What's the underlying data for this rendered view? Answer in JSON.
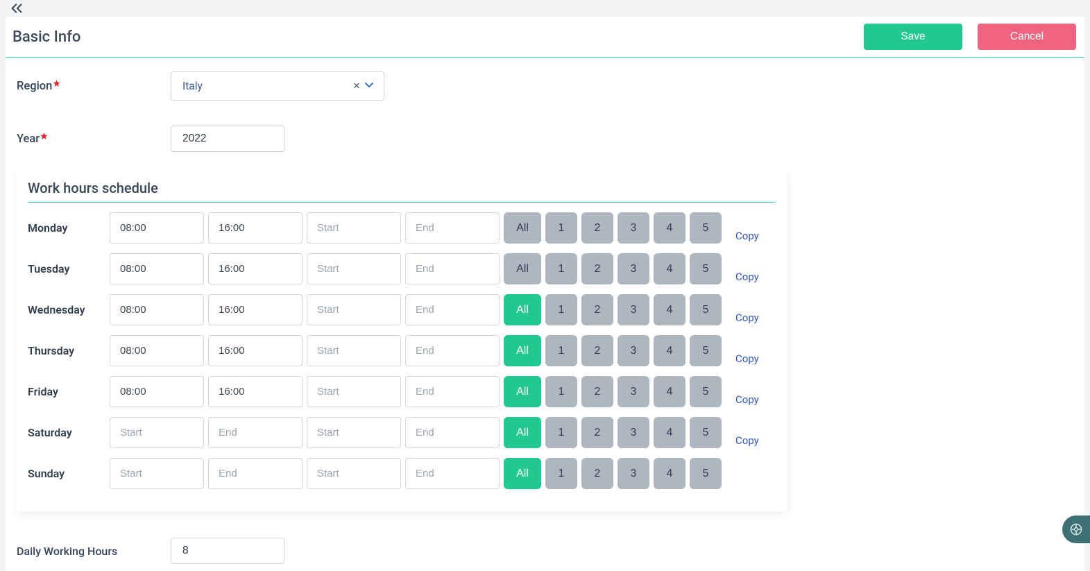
{
  "header": {
    "title": "Basic Info",
    "save_label": "Save",
    "cancel_label": "Cancel"
  },
  "form": {
    "region_label": "Region",
    "region_value": "Italy",
    "year_label": "Year",
    "year_value": "2022"
  },
  "schedule": {
    "title": "Work hours schedule",
    "placeholders": {
      "start": "Start",
      "end": "End"
    },
    "all_label": "All",
    "numbers": [
      "1",
      "2",
      "3",
      "4",
      "5"
    ],
    "copy_label": "Copy",
    "days": [
      {
        "name": "Monday",
        "start1": "08:00",
        "end1": "16:00",
        "start2": "",
        "end2": "",
        "all_active": false,
        "show_copy": true
      },
      {
        "name": "Tuesday",
        "start1": "08:00",
        "end1": "16:00",
        "start2": "",
        "end2": "",
        "all_active": false,
        "show_copy": true
      },
      {
        "name": "Wednesday",
        "start1": "08:00",
        "end1": "16:00",
        "start2": "",
        "end2": "",
        "all_active": true,
        "show_copy": true
      },
      {
        "name": "Thursday",
        "start1": "08:00",
        "end1": "16:00",
        "start2": "",
        "end2": "",
        "all_active": true,
        "show_copy": true
      },
      {
        "name": "Friday",
        "start1": "08:00",
        "end1": "16:00",
        "start2": "",
        "end2": "",
        "all_active": true,
        "show_copy": true
      },
      {
        "name": "Saturday",
        "start1": "",
        "end1": "",
        "start2": "",
        "end2": "",
        "all_active": true,
        "show_copy": true
      },
      {
        "name": "Sunday",
        "start1": "",
        "end1": "",
        "start2": "",
        "end2": "",
        "all_active": true,
        "show_copy": false
      }
    ]
  },
  "dwh": {
    "label": "Daily Working Hours",
    "value": "8"
  }
}
